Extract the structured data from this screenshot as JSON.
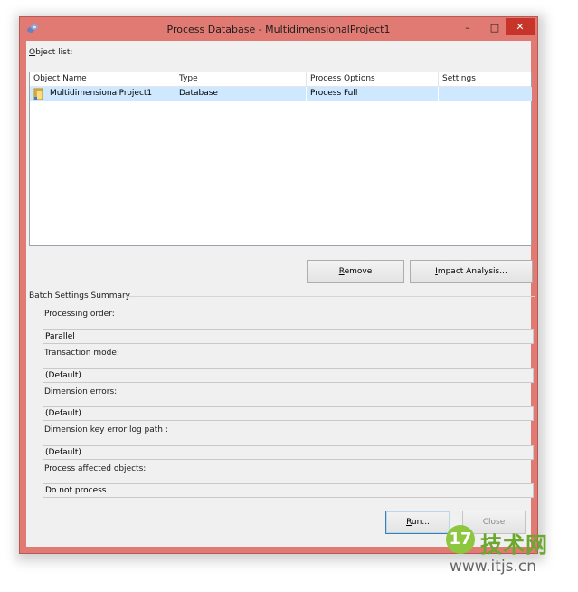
{
  "window": {
    "title": "Process Database - MultidimensionalProject1",
    "controls": {
      "minimize": "–",
      "maximize": "□",
      "close": "✕"
    }
  },
  "object_list": {
    "label_accel": "O",
    "label_rest": "bject list:",
    "columns": [
      "Object Name",
      "Type",
      "Process Options",
      "Settings"
    ],
    "rows": [
      {
        "name": "MultidimensionalProject1",
        "type": "Database",
        "process_options": "Process Full",
        "settings": ""
      }
    ]
  },
  "buttons": {
    "remove_accel": "R",
    "remove_rest": "emove",
    "impact_accel": "I",
    "impact_rest": "mpact Analysis...",
    "run_accel": "R",
    "run_rest": "un...",
    "close": "Close"
  },
  "batch": {
    "title": "Batch Settings Summary",
    "processing_order_label": "Processing order:",
    "processing_order_value": "Parallel",
    "transaction_mode_label": "Transaction mode:",
    "transaction_mode_value": "(Default)",
    "dimension_errors_label": "Dimension errors:",
    "dimension_errors_value": "(Default)",
    "key_error_log_label": "Dimension key error log path :",
    "key_error_log_value": "(Default)",
    "affected_objects_label": "Process affected objects:",
    "affected_objects_value": "Do not process"
  },
  "watermark": {
    "logo": "17",
    "name": "技术网",
    "url": "www.itjs.cn"
  },
  "colors": {
    "window_frame": "#e07a72",
    "selection": "#cde8ff",
    "close_button": "#c7342a"
  }
}
